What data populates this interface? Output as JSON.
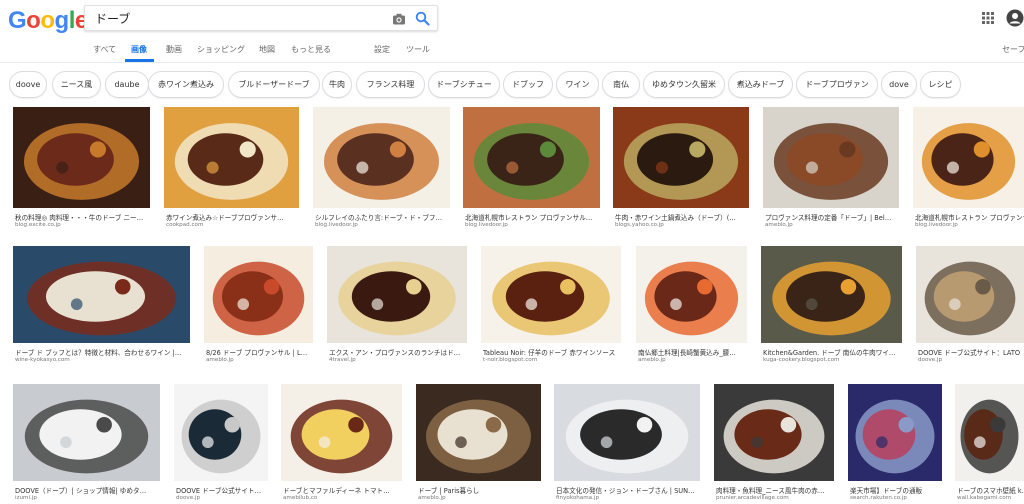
{
  "logo": {
    "letters": [
      "G",
      "o",
      "o",
      "g",
      "l",
      "e"
    ],
    "colors": [
      "#4285f4",
      "#ea4335",
      "#fbbc05",
      "#4285f4",
      "#34a853",
      "#ea4335"
    ]
  },
  "search": {
    "value": "ドーブ",
    "camera_icon": "camera-icon",
    "search_icon": "magnifier-icon"
  },
  "header": {
    "apps_icon": "apps-grid-icon",
    "account_icon": "account-icon"
  },
  "tabs": [
    {
      "label": "すべて",
      "active": false
    },
    {
      "label": "画像",
      "active": true
    },
    {
      "label": "動画",
      "active": false
    },
    {
      "label": "ショッピング",
      "active": false
    },
    {
      "label": "地図",
      "active": false
    },
    {
      "label": "もっと見る",
      "active": false
    },
    {
      "label": "設定",
      "active": false
    },
    {
      "label": "ツール",
      "active": false
    },
    {
      "label": "セーフ",
      "active": false
    }
  ],
  "chips": [
    "doove",
    "ニース風",
    "daube",
    "赤ワイン煮込み",
    "ブルドーザードーブ",
    "牛肉",
    "フランス料理",
    "ドーブシチュー",
    "ドブッフ",
    "ワイン",
    "南仏",
    "ゆめタウン久留米",
    "煮込みドーブ",
    "ドーブプロヴァン",
    "dove",
    "レシピ"
  ],
  "images": [
    {
      "caption": "秋の料理◎ 肉料理・・・牛のドーブ ニー…",
      "source": "blog.excite.co.jp",
      "colors": [
        "#3a1f14",
        "#6b2a1a",
        "#c77a2a"
      ]
    },
    {
      "caption": "赤ワイン煮込み☆ドーブプロヴァンサ…",
      "source": "cookpad.com",
      "colors": [
        "#e0a040",
        "#5a2a18",
        "#f2e6c8"
      ]
    },
    {
      "caption": "シルフレイのふたり言:ドーブ・ド・ブフ…",
      "source": "blog.livedoor.jp",
      "colors": [
        "#f4f0e6",
        "#5a3020",
        "#d08040"
      ]
    },
    {
      "caption": "北海道札幌市レストラン プロヴァンサル…",
      "source": "blog.livedoor.jp",
      "colors": [
        "#c07040",
        "#3a2418",
        "#5a8a3a"
      ]
    },
    {
      "caption": "牛肉・赤ワイン土鍋煮込み（ドーブ）(…",
      "source": "blogs.yahoo.co.jp",
      "colors": [
        "#8a3a18",
        "#2a1a10",
        "#b8a860"
      ]
    },
    {
      "caption": "プロヴァンス料理の定番「ドーブ」| Bel…",
      "source": "ameblo.jp",
      "colors": [
        "#d8d4cc",
        "#8a4a28",
        "#6a3a20"
      ]
    },
    {
      "caption": "北海道札幌市レストラン プロヴァンサル…",
      "source": "blog.livedoor.jp",
      "colors": [
        "#f6f0e6",
        "#4a2416",
        "#e0902a"
      ]
    },
    {
      "caption": "ドーブ ド ブッフとは？特徴と材料、合わせるワイン |…",
      "source": "wine-kyokasyo.com",
      "colors": [
        "#2a4a6a",
        "#e8e0d0",
        "#7a2a1a"
      ]
    },
    {
      "caption": "8/26 ドーブ プロヴァンサル | L…",
      "source": "ameblo.jp",
      "colors": [
        "#f4ede0",
        "#8a3018",
        "#c84a2a"
      ]
    },
    {
      "caption": "エクス・アン・プロヴァンスのランチはド…",
      "source": "4travel.jp",
      "colors": [
        "#e8e4dc",
        "#3a1a10",
        "#e8d090"
      ]
    },
    {
      "caption": "Tableau Noir: 仔羊のドーブ 赤ワインソース",
      "source": "t-noir.blogspot.com",
      "colors": [
        "#f6f2ea",
        "#5a2010",
        "#e8c060"
      ]
    },
    {
      "caption": "南仏郷土料理|長崎蟹黄込み_腰…",
      "source": "ameblo.jp",
      "colors": [
        "#f4f0ea",
        "#6a2818",
        "#e86a30"
      ]
    },
    {
      "caption": "Kitchen&Garden. ドーブ 南仏の牛肉ワイ…",
      "source": "kuga-cookery.blogspot.com",
      "colors": [
        "#5a5a4a",
        "#3a2418",
        "#e8a030"
      ]
    },
    {
      "caption": "DOOVE ドーブ公式サイト：LATO",
      "source": "doove.jp",
      "colors": [
        "#e8e4dc",
        "#b89a70",
        "#6a5a48"
      ]
    },
    {
      "caption": "DOOVE（ドーブ）| ショップ情報| ゆめタ…",
      "source": "izumi.jp",
      "colors": [
        "#c8ccd0",
        "#f2f2f2",
        "#4a4a4a"
      ]
    },
    {
      "caption": "DOOVE ドーブ公式サイト…",
      "source": "doove.jp",
      "colors": [
        "#f4f4f4",
        "#1a2a36",
        "#c8c8c8"
      ]
    },
    {
      "caption": "ドーブとマファルディーネ トマト…",
      "source": "amebilub.co",
      "colors": [
        "#f4f0e8",
        "#f2d060",
        "#6a2818"
      ]
    },
    {
      "caption": "ドーブ | Paris暮らし",
      "source": "ameblo.jp",
      "colors": [
        "#3a2a20",
        "#e8e0d0",
        "#8a6a48"
      ]
    },
    {
      "caption": "日本文化の発信・ジョン・ドーブさん | SUN…",
      "source": "finyokohama.jp",
      "colors": [
        "#d8dce0",
        "#2a2a2a",
        "#f2f2f2"
      ]
    },
    {
      "caption": "肉料理・魚料理_ニース風牛肉の赤…",
      "source": "prunier.arcadevillage.com",
      "colors": [
        "#3a3a3a",
        "#6a2a18",
        "#e8e4dc"
      ]
    },
    {
      "caption": "楽天市場】ドーブの通販",
      "source": "search.rakuten.co.jp",
      "colors": [
        "#2a2a6a",
        "#b04a6a",
        "#8a9ac8"
      ]
    },
    {
      "caption": "ドーブのスマホ壁紙 k…",
      "source": "wall.kabegami.com",
      "colors": [
        "#f2f0ec",
        "#5a2a18",
        "#3a3a3a"
      ]
    }
  ]
}
